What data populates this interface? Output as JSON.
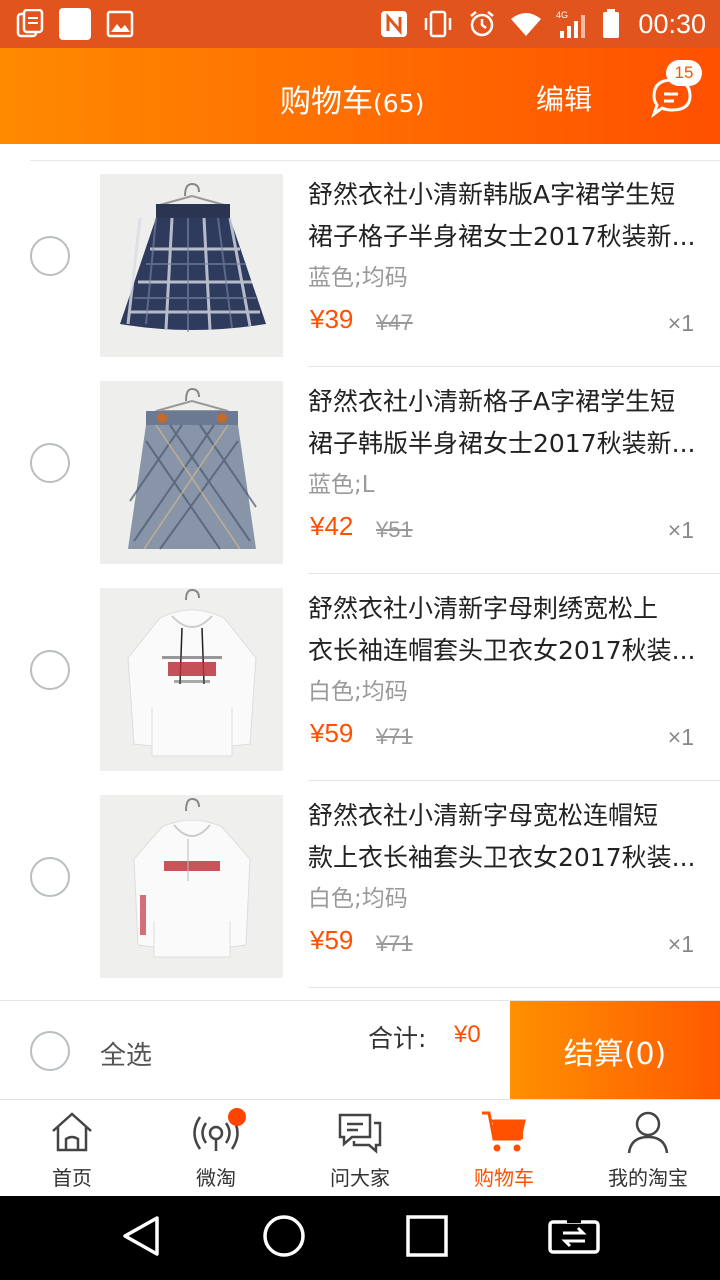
{
  "status_bar": {
    "time": "00:30",
    "icons_left": [
      "clipboard-icon",
      "blank-notification-icon",
      "image-icon"
    ],
    "icons_right": [
      "nfc-icon",
      "vibrate-icon",
      "alarm-icon",
      "wifi-icon",
      "signal-4g-icon",
      "battery-icon"
    ],
    "network_label": "4G"
  },
  "header": {
    "title": "购物车",
    "count": "(65)",
    "edit_label": "编辑",
    "message_badge": "15",
    "colors": {
      "gradient_start": "#ff8a00",
      "gradient_end": "#ff5000"
    }
  },
  "cart": {
    "items": [
      {
        "name_line1": "舒然衣社小清新韩版A字裙学生短",
        "name_line2": "裙子格子半身裙女士2017秋装新...",
        "spec": "蓝色;均码",
        "price": "¥39",
        "original_price": "¥47",
        "quantity": "×1",
        "image": "navy-plaid-skirt"
      },
      {
        "name_line1": "舒然衣社小清新格子A字裙学生短",
        "name_line2": "裙子韩版半身裙女士2017秋装新...",
        "spec": "蓝色;L",
        "price": "¥42",
        "original_price": "¥51",
        "quantity": "×1",
        "image": "grey-plaid-skirt"
      },
      {
        "name_line1": "舒然衣社小清新字母刺绣宽松上",
        "name_line2": "衣长袖连帽套头卫衣女2017秋装...",
        "spec": "白色;均码",
        "price": "¥59",
        "original_price": "¥71",
        "quantity": "×1",
        "image": "white-hoodie-print"
      },
      {
        "name_line1": "舒然衣社小清新字母宽松连帽短",
        "name_line2": "款上衣长袖套头卫衣女2017秋装...",
        "spec": "白色;均码",
        "price": "¥59",
        "original_price": "¥71",
        "quantity": "×1",
        "image": "white-hoodie-stripe"
      }
    ]
  },
  "checkout": {
    "select_all_label": "全选",
    "total_label": "合计:",
    "total_value": "¥0",
    "settle_label": "结算(0)"
  },
  "tabbar": {
    "tabs": [
      {
        "label": "首页",
        "icon": "home-icon"
      },
      {
        "label": "微淘",
        "icon": "broadcast-icon"
      },
      {
        "label": "问大家",
        "icon": "chat-icon"
      },
      {
        "label": "购物车",
        "icon": "cart-icon"
      },
      {
        "label": "我的淘宝",
        "icon": "user-icon"
      }
    ],
    "active_color": "#ff5000"
  },
  "navbar": {
    "buttons": [
      "back-icon",
      "home-circle-icon",
      "recents-icon",
      "screen-switch-icon"
    ]
  }
}
